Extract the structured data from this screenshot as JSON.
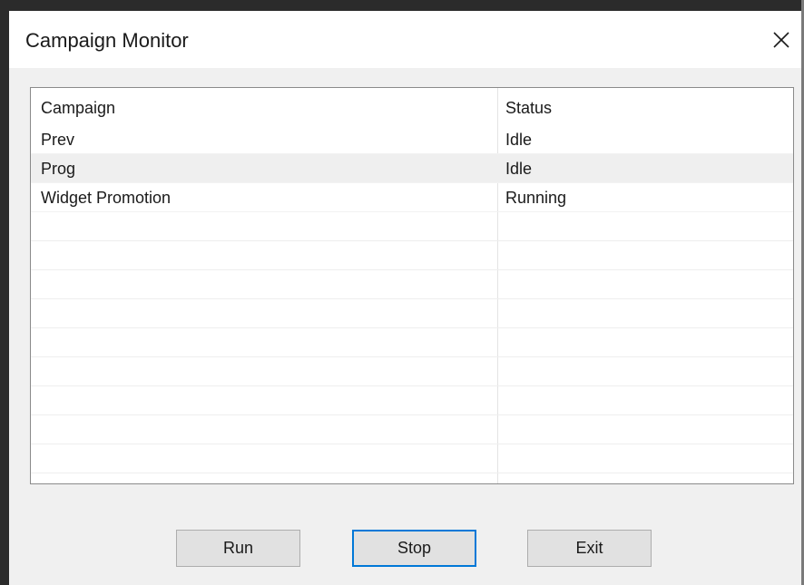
{
  "window": {
    "title": "Campaign Monitor"
  },
  "icons": {
    "close": "close-icon"
  },
  "list": {
    "columns": [
      "Campaign",
      "Status"
    ],
    "rows": [
      {
        "campaign": "Prev",
        "status": "Idle"
      },
      {
        "campaign": "Prog",
        "status": "Idle"
      },
      {
        "campaign": "Widget Promotion",
        "status": "Running"
      }
    ],
    "highlighted_row_index": 1
  },
  "buttons": {
    "run": "Run",
    "stop": "Stop",
    "exit": "Exit",
    "focused": "stop"
  },
  "colors": {
    "focus_border": "#0078d7",
    "row_highlight": "#efefef"
  }
}
